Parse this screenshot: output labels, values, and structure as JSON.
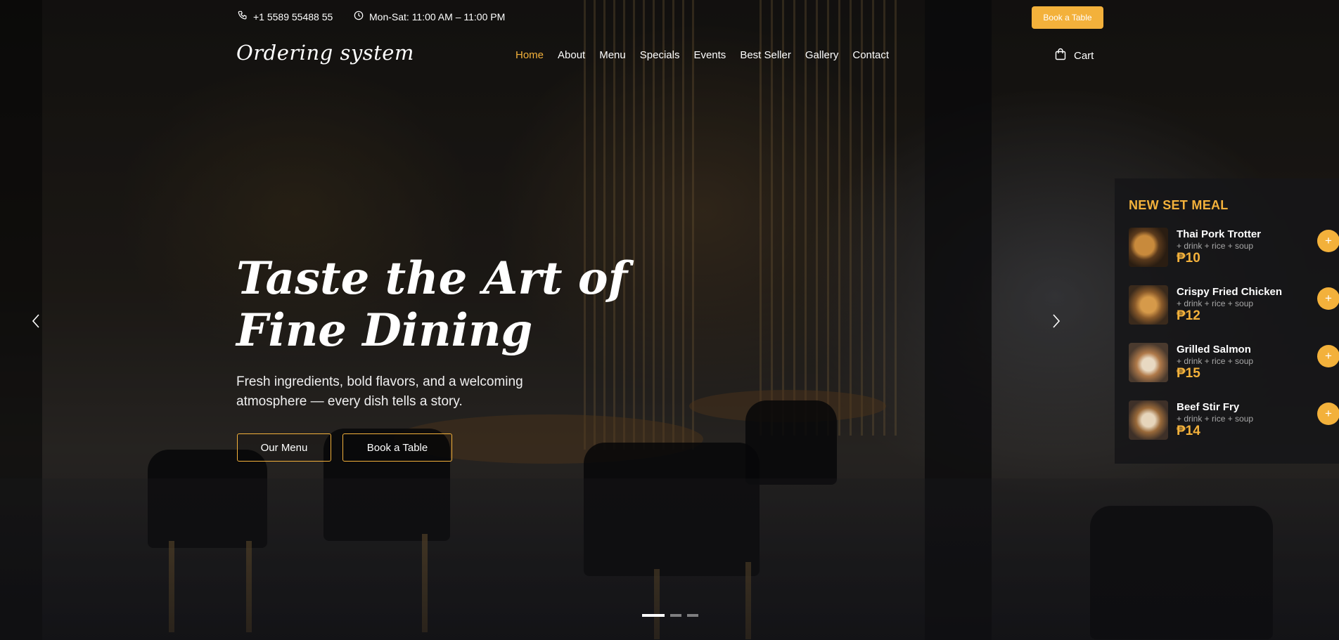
{
  "topbar": {
    "phone": "+1 5589 55488 55",
    "hours": "Mon-Sat: 11:00 AM – 11:00 PM",
    "book_label": "Book a Table"
  },
  "header": {
    "logo": "Ordering system",
    "nav": [
      "Home",
      "About",
      "Menu",
      "Specials",
      "Events",
      "Best Seller",
      "Gallery",
      "Contact"
    ],
    "active_nav": "Home",
    "cart_label": "Cart"
  },
  "hero": {
    "title": "Taste the Art of Fine Dining",
    "subtitle": "Fresh ingredients, bold flavors, and a welcoming atmosphere — every dish tells a story.",
    "menu_button": "Our Menu",
    "book_button": "Book a Table"
  },
  "carousel": {
    "slide_count": 3,
    "active_slide": 1
  },
  "set_meal": {
    "title": "NEW SET MEAL",
    "items": [
      {
        "name": "Thai Pork Trotter",
        "desc": "+ drink + rice + soup",
        "price": "₱10"
      },
      {
        "name": "Crispy Fried Chicken",
        "desc": "+ drink + rice + soup",
        "price": "₱12"
      },
      {
        "name": "Grilled Salmon",
        "desc": "+ drink + rice + soup",
        "price": "₱15"
      },
      {
        "name": "Beef Stir Fry",
        "desc": "+ drink + rice + soup",
        "price": "₱14"
      }
    ]
  },
  "colors": {
    "accent": "#f3b13b",
    "panel": "#161618",
    "text": "#ffffff"
  }
}
